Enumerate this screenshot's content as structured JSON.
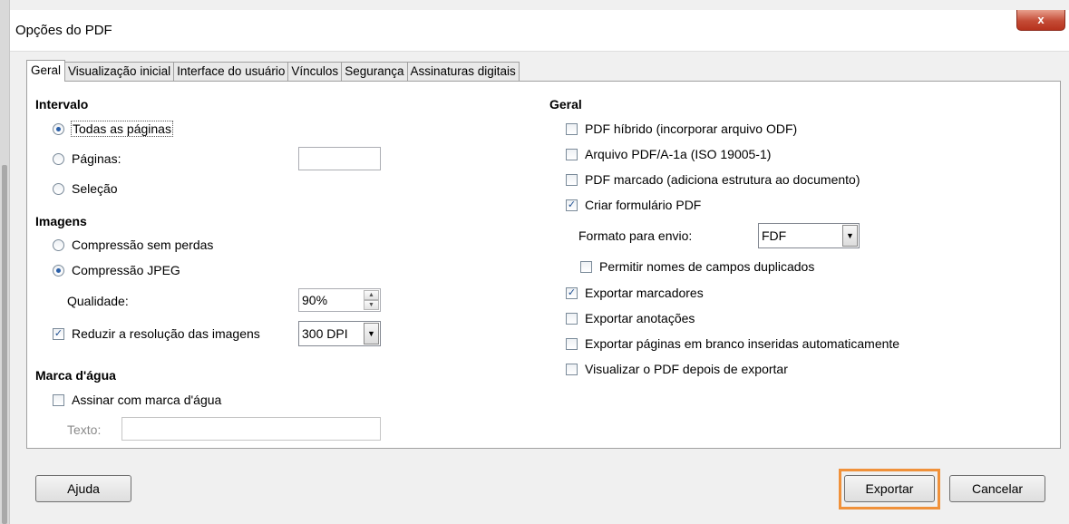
{
  "window": {
    "title": "Opções do PDF",
    "close_label": "x"
  },
  "tabs": [
    {
      "label": "Geral",
      "active": true
    },
    {
      "label": "Visualização inicial"
    },
    {
      "label": "Interface do usuário"
    },
    {
      "label": "Vínculos"
    },
    {
      "label": "Segurança"
    },
    {
      "label": "Assinaturas digitais"
    }
  ],
  "intervalo": {
    "title": "Intervalo",
    "all_pages": "Todas as páginas",
    "pages": "Páginas:",
    "pages_value": "",
    "selection": "Seleção"
  },
  "imagens": {
    "title": "Imagens",
    "lossless": "Compressão sem perdas",
    "jpeg": "Compressão JPEG",
    "quality_label": "Qualidade:",
    "quality_value": "90%",
    "reduce_label": "Reduzir a resolução das imagens",
    "reduce_value": "300 DPI"
  },
  "watermark": {
    "title": "Marca d'água",
    "sign_label": "Assinar com marca d'água",
    "text_label": "Texto:",
    "text_value": ""
  },
  "geral": {
    "title": "Geral",
    "hybrid": "PDF híbrido (incorporar arquivo ODF)",
    "pdfa": "Arquivo PDF/A-1a (ISO 19005-1)",
    "tagged": "PDF marcado (adiciona estrutura ao documento)",
    "form": "Criar formulário PDF",
    "submit_format_label": "Formato para envio:",
    "submit_format_value": "FDF",
    "duplicate_fields": "Permitir nomes de campos duplicados",
    "bookmarks": "Exportar marcadores",
    "comments": "Exportar anotações",
    "blank_pages": "Exportar páginas em branco inseridas automaticamente",
    "view_after": "Visualizar o PDF depois de exportar"
  },
  "buttons": {
    "help": "Ajuda",
    "export": "Exportar",
    "cancel": "Cancelar"
  },
  "colors": {
    "highlight": "#f0913a",
    "close": "#c44c36"
  }
}
